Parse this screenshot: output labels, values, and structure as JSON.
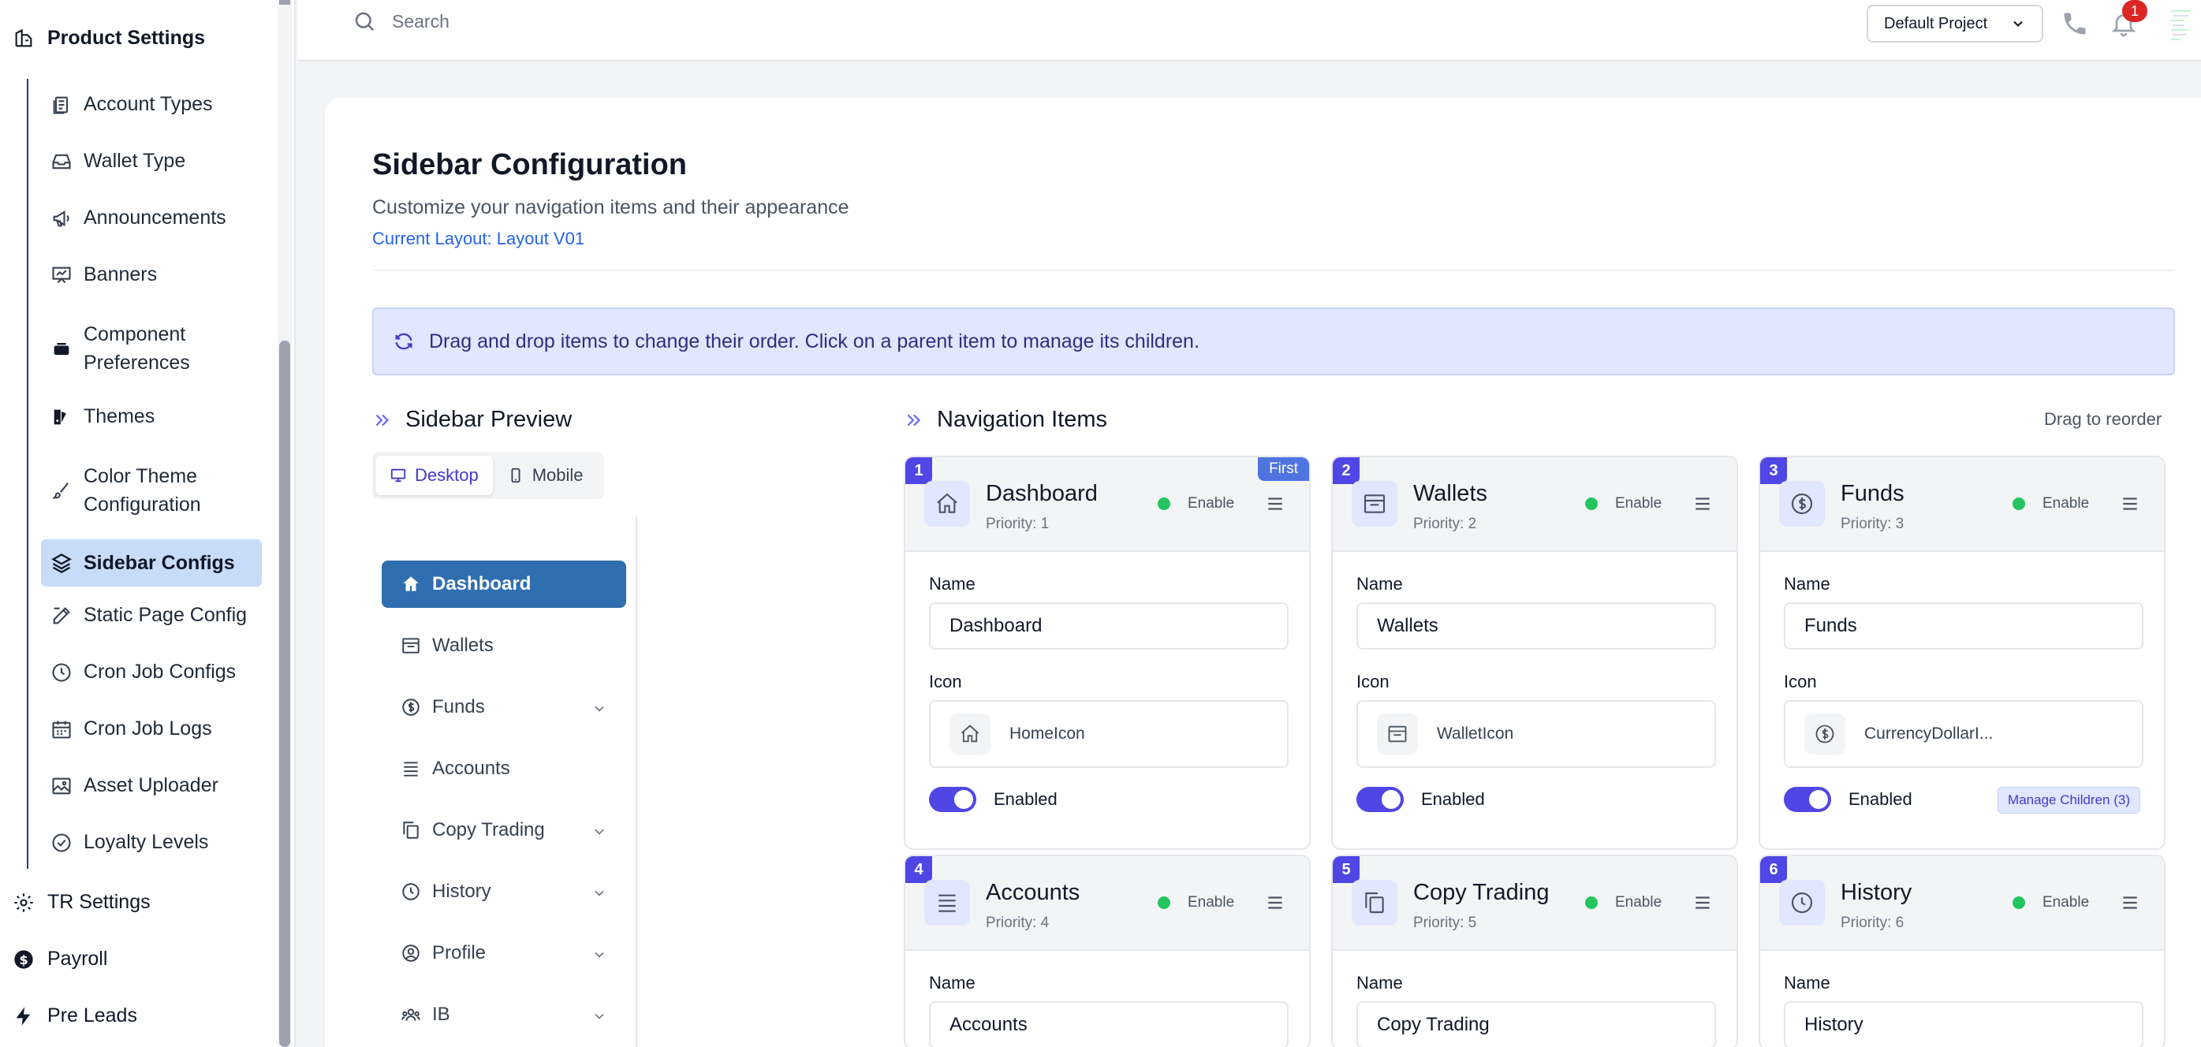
{
  "sidebar": {
    "sections": [
      {
        "label": "Product Settings",
        "icon": "product-icon"
      },
      {
        "label": "TR Settings",
        "icon": "gear-icon"
      },
      {
        "label": "Payroll",
        "icon": "dollar-icon"
      },
      {
        "label": "Pre Leads",
        "icon": "bolt-icon"
      }
    ],
    "items": [
      {
        "label": "Account Types",
        "icon": "document-icon"
      },
      {
        "label": "Wallet Type",
        "icon": "inbox-icon"
      },
      {
        "label": "Announcements",
        "icon": "megaphone-icon"
      },
      {
        "label": "Banners",
        "icon": "presentation-icon"
      },
      {
        "label": "Component Preferences",
        "icon": "layers-icon"
      },
      {
        "label": "Themes",
        "icon": "palette-icon"
      },
      {
        "label": "Color Theme Configuration",
        "icon": "brush-icon"
      },
      {
        "label": "Sidebar Configs",
        "icon": "stack-icon"
      },
      {
        "label": "Static Page Config",
        "icon": "edit-icon"
      },
      {
        "label": "Cron Job Configs",
        "icon": "clock-icon"
      },
      {
        "label": "Cron Job Logs",
        "icon": "calendar-icon"
      },
      {
        "label": "Asset Uploader",
        "icon": "image-icon"
      },
      {
        "label": "Loyalty Levels",
        "icon": "check-circle-icon"
      }
    ]
  },
  "topbar": {
    "search_placeholder": "Search",
    "project": "Default Project",
    "notification_count": "1"
  },
  "page": {
    "title": "Sidebar Configuration",
    "subtitle": "Customize your navigation items and their appearance",
    "layout": "Current Layout: Layout V01",
    "banner": "Drag and drop items to change their order. Click on a parent item to manage its children."
  },
  "preview": {
    "title": "Sidebar Preview",
    "tabs": {
      "desktop": "Desktop",
      "mobile": "Mobile"
    },
    "items": [
      {
        "label": "Dashboard"
      },
      {
        "label": "Wallets"
      },
      {
        "label": "Funds"
      },
      {
        "label": "Accounts"
      },
      {
        "label": "Copy Trading"
      },
      {
        "label": "History"
      },
      {
        "label": "Profile"
      },
      {
        "label": "IB"
      }
    ]
  },
  "nav": {
    "title": "Navigation Items",
    "hint": "Drag to reorder",
    "labels": {
      "name": "Name",
      "icon": "Icon",
      "enabled": "Enabled",
      "enable": "Enable",
      "first": "First"
    },
    "cards": [
      {
        "num": "1",
        "title": "Dashboard",
        "priority": "Priority: 1",
        "name": "Dashboard",
        "icon_name": "HomeIcon"
      },
      {
        "num": "2",
        "title": "Wallets",
        "priority": "Priority: 2",
        "name": "Wallets",
        "icon_name": "WalletIcon"
      },
      {
        "num": "3",
        "title": "Funds",
        "priority": "Priority: 3",
        "name": "Funds",
        "icon_name": "CurrencyDollarI...",
        "manage": "Manage Children (3)"
      },
      {
        "num": "4",
        "title": "Accounts",
        "priority": "Priority: 4",
        "name": "Accounts"
      },
      {
        "num": "5",
        "title": "Copy Trading",
        "priority": "Priority: 5",
        "name": "Copy Trading"
      },
      {
        "num": "6",
        "title": "History",
        "priority": "Priority: 6",
        "name": "History"
      }
    ]
  },
  "colors": {
    "accent": "#4f46e5",
    "active_sidebar": "#c7dcf8",
    "preview_active": "#2f6fb0",
    "status_green": "#22c55e"
  }
}
